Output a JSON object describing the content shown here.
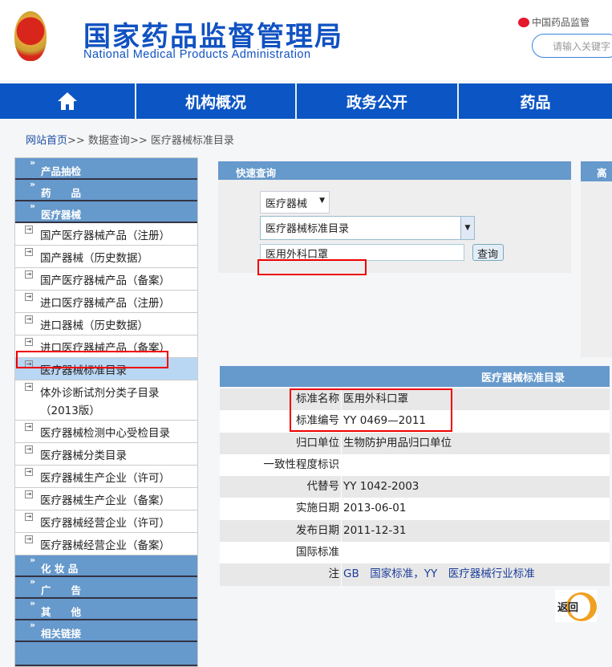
{
  "header": {
    "title_cn": "国家药品监督管理局",
    "title_en": "National Medical Products Administration",
    "weibo": "中国药品监管",
    "search_placeholder": "请输入关键字"
  },
  "nav": {
    "icon": "home-icon",
    "items": [
      "机构概况",
      "政务公开",
      "药品"
    ]
  },
  "breadcrumb": [
    "网站首页",
    ">> 数据查询",
    ">> 医疗器械标准目录"
  ],
  "sidebar": {
    "sections_top": [
      "产品抽检",
      "药　　品",
      "医疗器械"
    ],
    "items": [
      "国产医疗器械产品（注册）",
      "国产器械（历史数据）",
      "国产医疗器械产品（备案）",
      "进口医疗器械产品（注册）",
      "进口器械（历史数据）",
      "进口医疗器械产品（备案）",
      "医疗器械标准目录",
      "体外诊断试剂分类子目录（2013版）",
      "医疗器械检测中心受检目录",
      "医疗器械分类目录",
      "医疗器械生产企业（许可）",
      "医疗器械生产企业（备案）",
      "医疗器械经营企业（许可）",
      "医疗器械经营企业（备案）"
    ],
    "selected": "医疗器械标准目录",
    "sections_bottom": [
      "化 妆 品",
      "广　　告",
      "其　　他",
      "相关链接"
    ]
  },
  "quick_search": {
    "title": "快速查询",
    "category": "医疗器械",
    "catalog": "医疗器械标准目录",
    "keyword": "医用外科口罩",
    "button": "查询"
  },
  "advanced": {
    "title": "高"
  },
  "result": {
    "title": "医疗器械标准目录",
    "rows": [
      {
        "label": "标准名称",
        "value": "医用外科口罩"
      },
      {
        "label": "标准编号",
        "value": "YY 0469—2011"
      },
      {
        "label": "归口单位",
        "value": "生物防护用品归口单位"
      },
      {
        "label": "一致性程度标识",
        "value": ""
      },
      {
        "label": "代替号",
        "value": "YY 1042-2003"
      },
      {
        "label": "实施日期",
        "value": "2013-06-01"
      },
      {
        "label": "发布日期",
        "value": "2011-12-31"
      },
      {
        "label": "国际标准",
        "value": ""
      },
      {
        "label": "注",
        "value": "GB　国家标准，YY　医疗器械行业标准"
      }
    ]
  },
  "back_button": "返回",
  "colors": {
    "nav": "#0b55c4",
    "panel_header": "#6699cc",
    "highlight": "#e00000"
  }
}
